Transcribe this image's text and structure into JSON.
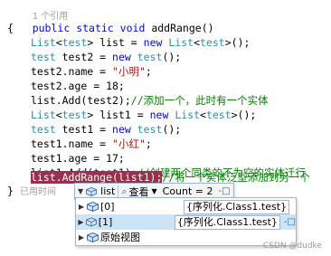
{
  "code": {
    "refs_top": "1 个引用",
    "line_sig_kw1": "public",
    "line_sig_kw2": "static",
    "line_sig_kw3": "void",
    "line_sig_name": "addRange()",
    "brace_open": "{",
    "l1_type": "List",
    "l1_lt": "<",
    "l1_type2": "test",
    "l1_rest": "> list = ",
    "l1_new": "new",
    "l1_type3": "List",
    "l1_lt2": "<",
    "l1_type4": "test",
    "l1_end": ">();",
    "l2_type": "test",
    "l2_rest": " test2 = ",
    "l2_new": "new",
    "l2_type2": "test",
    "l2_end": "();",
    "l3_a": "test2.name = ",
    "l3_str": "\"小明\"",
    "l3_end": ";",
    "l4": "test2.age = 18;",
    "l5_a": "list.Add(test2);",
    "l5_c": "//添加一个，此时有一个实体",
    "l6_type": "List",
    "l6_lt": "<",
    "l6_type2": "test",
    "l6_rest": "> list1 = ",
    "l6_new": "new",
    "l6_type3": "List",
    "l6_lt2": "<",
    "l6_type4": "test",
    "l6_end": ">();",
    "l7_type": "test",
    "l7_rest": " test1 = ",
    "l7_new": "new",
    "l7_type2": "test",
    "l7_end": "();",
    "l8_a": "test1.name = ",
    "l8_str": "\"小红\"",
    "l8_end": ";",
    "l9": "test1.age = 17;",
    "l10_a": "list1.Add(test1);",
    "l10_c": "//创建两个同类的不为空的实体迁行",
    "l11_a": "list.AddRange(list1);",
    "l11_c": "//将一个实体泛型添加到另一个",
    "brace_close": "}",
    "elapsed": "已用时间"
  },
  "datatip": {
    "var_name": "list",
    "view_label": "查看",
    "summary": "Count = 2"
  },
  "items": [
    {
      "name": "[0]",
      "value": "{序列化.Class1.test}"
    },
    {
      "name": "[1]",
      "value": "{序列化.Class1.test}"
    },
    {
      "name": "原始视图",
      "value": ""
    }
  ],
  "watermark": "CSDN @dudke"
}
